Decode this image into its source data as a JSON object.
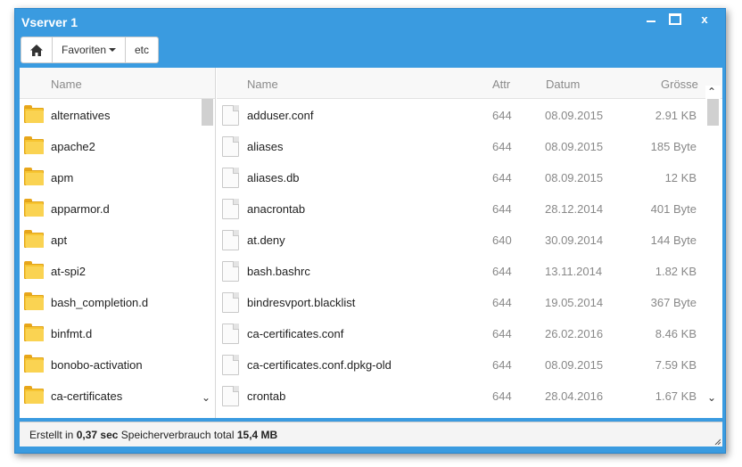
{
  "window": {
    "title": "Vserver 1",
    "close_label": "x"
  },
  "toolbar": {
    "favorites_label": "Favoriten",
    "etc_label": "etc"
  },
  "left_pane": {
    "header_name": "Name",
    "folders": [
      "alternatives",
      "apache2",
      "apm",
      "apparmor.d",
      "apt",
      "at-spi2",
      "bash_completion.d",
      "binfmt.d",
      "bonobo-activation",
      "ca-certificates"
    ]
  },
  "right_pane": {
    "headers": {
      "name": "Name",
      "attr": "Attr",
      "date": "Datum",
      "size": "Grösse"
    },
    "files": [
      {
        "name": "adduser.conf",
        "attr": "644",
        "date": "08.09.2015",
        "size": "2.91 KB"
      },
      {
        "name": "aliases",
        "attr": "644",
        "date": "08.09.2015",
        "size": "185 Byte"
      },
      {
        "name": "aliases.db",
        "attr": "644",
        "date": "08.09.2015",
        "size": "12 KB"
      },
      {
        "name": "anacrontab",
        "attr": "644",
        "date": "28.12.2014",
        "size": "401 Byte"
      },
      {
        "name": "at.deny",
        "attr": "640",
        "date": "30.09.2014",
        "size": "144 Byte"
      },
      {
        "name": "bash.bashrc",
        "attr": "644",
        "date": "13.11.2014",
        "size": "1.82 KB"
      },
      {
        "name": "bindresvport.blacklist",
        "attr": "644",
        "date": "19.05.2014",
        "size": "367 Byte"
      },
      {
        "name": "ca-certificates.conf",
        "attr": "644",
        "date": "26.02.2016",
        "size": "8.46 KB"
      },
      {
        "name": "ca-certificates.conf.dpkg-old",
        "attr": "644",
        "date": "08.09.2015",
        "size": "7.59 KB"
      },
      {
        "name": "crontab",
        "attr": "644",
        "date": "28.04.2016",
        "size": "1.67 KB"
      }
    ]
  },
  "status": {
    "prefix": "Erstellt in",
    "time": "0,37 sec",
    "memory_label": "Speicherverbrauch total",
    "memory": "15,4 MB"
  },
  "icons": {
    "home": "home-icon",
    "folder": "folder-icon",
    "file": "file-icon",
    "scroll_up": "chevron-up-icon",
    "scroll_down": "chevron-down-icon"
  },
  "colors": {
    "window_accent": "#3a9be0",
    "folder": "#f7c531"
  }
}
